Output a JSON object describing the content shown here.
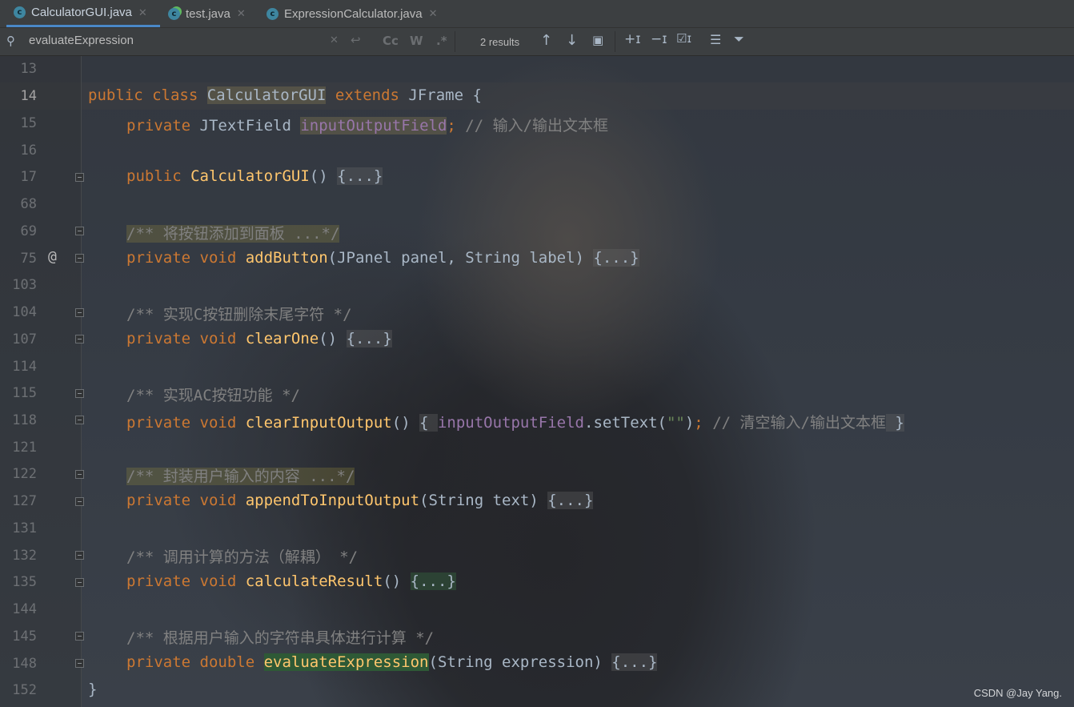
{
  "tabs": [
    {
      "label": "CalculatorGUI.java",
      "icon": "java-class-icon"
    },
    {
      "label": "test.java",
      "icon": "java-runnable-class-icon"
    },
    {
      "label": "ExpressionCalculator.java",
      "icon": "java-class-icon"
    }
  ],
  "search": {
    "query": "evaluateExpression",
    "results": "2 results",
    "match_case_label": "Cc",
    "words_label": "W",
    "regex_label": ".*"
  },
  "gutter": {
    "line_numbers": [
      "13",
      "14",
      "15",
      "16",
      "17",
      "68",
      "69",
      "75",
      "103",
      "104",
      "107",
      "114",
      "115",
      "118",
      "121",
      "122",
      "127",
      "131",
      "132",
      "135",
      "144",
      "145",
      "148",
      "152"
    ],
    "override_marker": "@"
  },
  "code": {
    "l14": {
      "kw1": "public class ",
      "cls": "CalculatorGUI",
      "kw2": " extends ",
      "rest": "JFrame {"
    },
    "l15": {
      "kw": "private ",
      "type": "JTextField ",
      "field": "inputOutputField",
      "semi": ";",
      "comment": " // 输入/输出文本框"
    },
    "l17": {
      "kw": "public ",
      "name": "CalculatorGUI",
      "paren": "() ",
      "folded": "{...}"
    },
    "l69": {
      "comment": "/** 将按钮添加到面板 ...*/"
    },
    "l75": {
      "kw": "private void ",
      "name": "addButton",
      "params": "(JPanel panel, String label) ",
      "folded": "{...}"
    },
    "l104": {
      "comment": "/** 实现C按钮删除末尾字符 */"
    },
    "l107": {
      "kw": "private void ",
      "name": "clearOne",
      "paren": "() ",
      "folded": "{...}"
    },
    "l115": {
      "comment": "/** 实现AC按钮功能 */"
    },
    "l118": {
      "kw": "private void ",
      "name": "clearInputOutput",
      "paren": "() ",
      "open": "{ ",
      "field": "inputOutputField",
      "call": ".setText(",
      "str": "\"\"",
      "close": ")",
      "semi": ";",
      "comment": " // 清空输入/输出文本框",
      "end": " }"
    },
    "l122": {
      "comment": "/** 封装用户输入的内容 ...*/"
    },
    "l127": {
      "kw": "private void ",
      "name": "appendToInputOutput",
      "params": "(String text) ",
      "folded": "{...}"
    },
    "l132": {
      "comment": "/** 调用计算的方法（解耦） */"
    },
    "l135": {
      "kw": "private void ",
      "name": "calculateResult",
      "paren": "() ",
      "folded": "{...}"
    },
    "l145": {
      "comment": "/** 根据用户输入的字符串具体进行计算 */"
    },
    "l148": {
      "kw": "private double ",
      "name": "evaluateExpression",
      "params": "(String expression) ",
      "folded": "{...}"
    },
    "l152": {
      "text": "}"
    }
  },
  "watermark": "CSDN @Jay Yang.",
  "colors": {
    "keyword": "#cc7832",
    "method": "#ffc66d",
    "field": "#9876aa",
    "comment": "#808080",
    "string": "#6a8759",
    "tab_underline": "#4a88c7"
  }
}
